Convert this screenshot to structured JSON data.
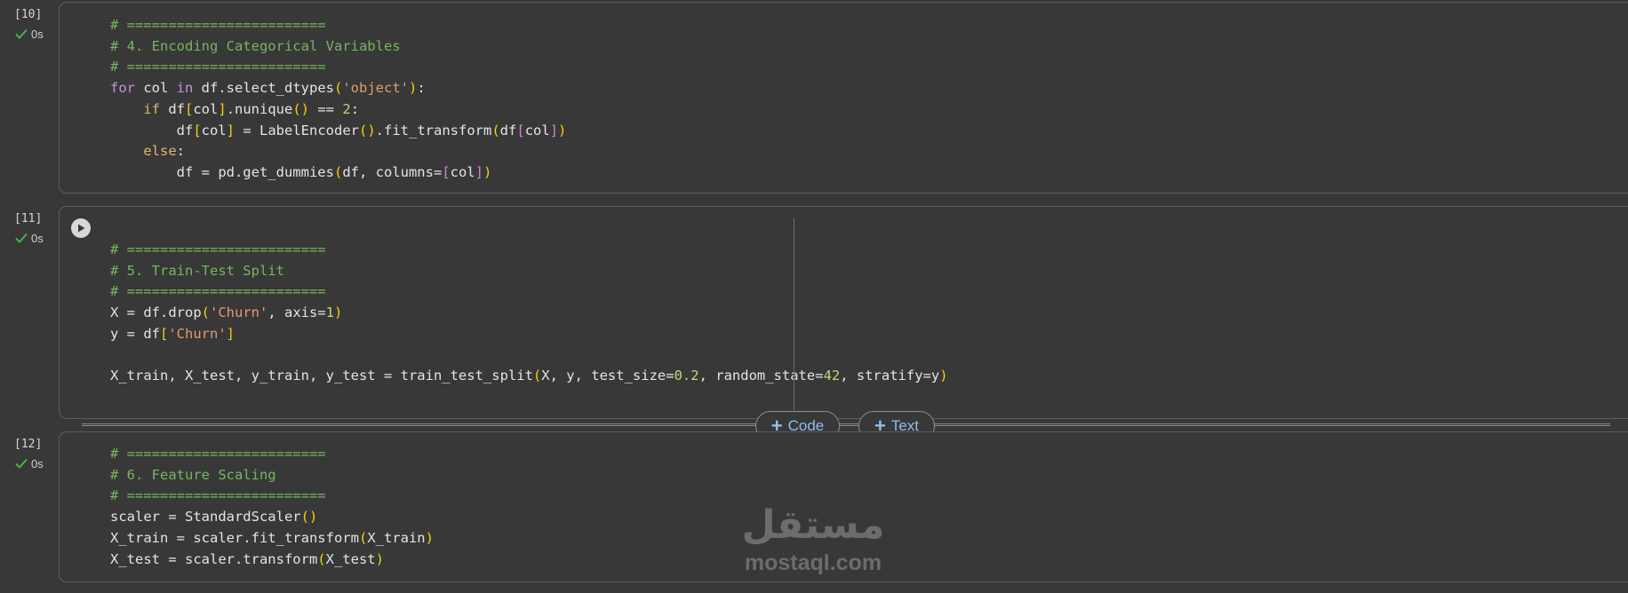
{
  "cells": [
    {
      "exec_count": "[10]",
      "status_time": "0s",
      "lines": [
        [
          {
            "t": "# ========================",
            "c": "c"
          }
        ],
        [
          {
            "t": "# 4. Encoding Categorical Variables",
            "c": "c"
          }
        ],
        [
          {
            "t": "# ========================",
            "c": "c"
          }
        ],
        [
          {
            "t": "for",
            "c": "k"
          },
          {
            "t": " col "
          },
          {
            "t": "in",
            "c": "k"
          },
          {
            "t": " df.select_dtypes"
          },
          {
            "t": "(",
            "c": "p1"
          },
          {
            "t": "'object'",
            "c": "s"
          },
          {
            "t": ")",
            "c": "p1"
          },
          {
            "t": ":"
          }
        ],
        [
          {
            "t": "    "
          },
          {
            "t": "if",
            "c": "kw"
          },
          {
            "t": " df"
          },
          {
            "t": "[",
            "c": "p1"
          },
          {
            "t": "col"
          },
          {
            "t": "]",
            "c": "p1"
          },
          {
            "t": ".nunique"
          },
          {
            "t": "()",
            "c": "p1"
          },
          {
            "t": " == "
          },
          {
            "t": "2",
            "c": "n"
          },
          {
            "t": ":"
          }
        ],
        [
          {
            "t": "        df"
          },
          {
            "t": "[",
            "c": "p1"
          },
          {
            "t": "col"
          },
          {
            "t": "]",
            "c": "p1"
          },
          {
            "t": " = LabelEncoder"
          },
          {
            "t": "()",
            "c": "p1"
          },
          {
            "t": ".fit_transform"
          },
          {
            "t": "(",
            "c": "p1"
          },
          {
            "t": "df"
          },
          {
            "t": "[",
            "c": "p2"
          },
          {
            "t": "col"
          },
          {
            "t": "]",
            "c": "p2"
          },
          {
            "t": ")",
            "c": "p1"
          }
        ],
        [
          {
            "t": "    "
          },
          {
            "t": "else",
            "c": "kw"
          },
          {
            "t": ":"
          }
        ],
        [
          {
            "t": "        df = pd.get_dummies"
          },
          {
            "t": "(",
            "c": "p1"
          },
          {
            "t": "df, columns="
          },
          {
            "t": "[",
            "c": "p2"
          },
          {
            "t": "col"
          },
          {
            "t": "]",
            "c": "p2"
          },
          {
            "t": ")",
            "c": "p1"
          }
        ]
      ]
    },
    {
      "exec_count": "[11]",
      "status_time": "0s",
      "lines": [
        [
          {
            "t": "# ========================",
            "c": "c"
          }
        ],
        [
          {
            "t": "# 5. Train-Test Split",
            "c": "c"
          }
        ],
        [
          {
            "t": "# ========================",
            "c": "c"
          }
        ],
        [
          {
            "t": "X = df.drop"
          },
          {
            "t": "(",
            "c": "p1"
          },
          {
            "t": "'Churn'",
            "c": "s"
          },
          {
            "t": ", axis="
          },
          {
            "t": "1",
            "c": "n"
          },
          {
            "t": ")",
            "c": "p1"
          }
        ],
        [
          {
            "t": "y = df"
          },
          {
            "t": "[",
            "c": "p1"
          },
          {
            "t": "'Churn'",
            "c": "s"
          },
          {
            "t": "]",
            "c": "p1"
          }
        ],
        [
          {
            "t": ""
          }
        ],
        [
          {
            "t": "X_train, X_test, y_train, y_test = train_test_split"
          },
          {
            "t": "(",
            "c": "p1"
          },
          {
            "t": "X, y, test_size="
          },
          {
            "t": "0.2",
            "c": "n"
          },
          {
            "t": ", random_state="
          },
          {
            "t": "42",
            "c": "n"
          },
          {
            "t": ", stratify=y"
          },
          {
            "t": ")",
            "c": "p1"
          }
        ]
      ]
    },
    {
      "exec_count": "[12]",
      "status_time": "0s",
      "lines": [
        [
          {
            "t": "# ========================",
            "c": "c"
          }
        ],
        [
          {
            "t": "# 6. Feature Scaling",
            "c": "c"
          }
        ],
        [
          {
            "t": "# ========================",
            "c": "c"
          }
        ],
        [
          {
            "t": "scaler = StandardScaler"
          },
          {
            "t": "()",
            "c": "p1"
          }
        ],
        [
          {
            "t": "X_train = scaler.fit_transform"
          },
          {
            "t": "(",
            "c": "p1"
          },
          {
            "t": "X_train"
          },
          {
            "t": ")",
            "c": "p1"
          }
        ],
        [
          {
            "t": "X_test = scaler.transform"
          },
          {
            "t": "(",
            "c": "p1"
          },
          {
            "t": "X_test"
          },
          {
            "t": ")",
            "c": "p1"
          }
        ]
      ]
    }
  ],
  "toolbar": {
    "add_code_label": "Code",
    "add_text_label": "Text"
  },
  "watermark": {
    "arabic": "مستقل",
    "latin": "mostaql.com"
  },
  "icons": {
    "status": "check-icon",
    "run": "play-icon",
    "add": "plus-icon"
  },
  "colors": {
    "background": "#383838",
    "comment": "#76b561",
    "string": "#e49b6e",
    "number": "#b6dc7c",
    "keyword_loop": "#c792e0",
    "keyword_branch": "#d9b96a",
    "bracket_outer": "#f5d10a",
    "bracket_inner": "#d680d6",
    "success": "#4cae4c",
    "link": "#8fbdf0"
  }
}
